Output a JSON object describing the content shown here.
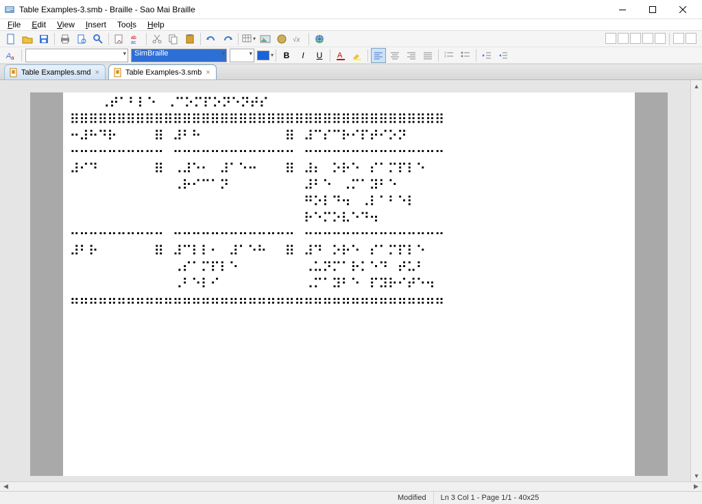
{
  "title": "Table Examples-3.smb - Braille - Sao Mai Braille",
  "menubar": [
    "File",
    "Edit",
    "View",
    "Insert",
    "Tools",
    "Help"
  ],
  "menubar_accel": [
    "F",
    "E",
    "V",
    "I",
    "l",
    "H"
  ],
  "toolbar1": {
    "new": "new",
    "open": "open",
    "save": "save",
    "print": "print",
    "preview": "preview",
    "find": "find",
    "goto": "goto",
    "abac": "abac",
    "cut": "cut",
    "copy": "copy",
    "paste": "paste",
    "undo": "undo",
    "redo": "redo",
    "table": "table",
    "image": "image",
    "link": "link",
    "formula": "formula",
    "globe": "globe"
  },
  "toolbar2": {
    "font_label": "",
    "translation_label": "SimBraille",
    "size_label": "",
    "color": "#1a63d9",
    "bold": "B",
    "italic": "I",
    "underline": "U"
  },
  "tabs": [
    {
      "label": "Table Examples.smd",
      "active": false
    },
    {
      "label": "Table Examples-3.smb",
      "active": true
    }
  ],
  "braille_lines": [
    "    ⠠⠞⠁⠃⠇⠑⠀⠠⠉⠕⠍⠏⠕⠝⠑⠝⠞⠎",
    "⠿⠿⠿⠿⠿⠿⠿⠿⠿⠿⠿⠿⠿⠿⠿⠿⠿⠿⠿⠿⠿⠿⠿⠿⠿⠿⠿⠿⠿⠿⠿⠿⠿⠿⠿⠿⠿⠿⠿⠿",
    "⠒⠼⠓⠙⠗⠀⠀⠀⠀⠿⠀⠼⠃⠓⠀⠀⠀⠀⠀⠀⠀⠀⠀⠿⠀⠼⠉⠎⠉⠗⠊⠏⠞⠊⠕⠝",
    "⠒⠒⠒⠒⠒⠒⠒⠒⠒⠒⠀⠒⠒⠒⠒⠒⠒⠒⠒⠒⠒⠒⠒⠒⠀⠒⠒⠒⠒⠒⠒⠒⠒⠒⠒⠒⠒⠒⠒⠒",
    "⠼⠊⠙⠀⠀⠀⠀⠀⠀⠿⠀⠠⠼⠑⠂⠀⠼⠁⠑⠒⠀⠀⠀⠿⠀⠼⠆⠀⠕⠗⠑⠀⠎⠁⠍⠏⠇⠑",
    "⠀⠀⠀⠀⠀⠀⠀⠀⠀⠀⠀⠠⠗⠊⠉⠁⠝⠀⠀⠀⠀⠀⠀⠀⠀⠼⠃⠑⠀⠠⠍⠁⠽⠃⠑",
    "⠀⠀⠀⠀⠀⠀⠀⠀⠀⠀⠀⠀⠀⠀⠀⠀⠀⠀⠀⠀⠀⠀⠀⠀⠀⠛⠕⠇⠙⠲⠀⠠⠇⠁⠃⠑⠇",
    "⠀⠀⠀⠀⠀⠀⠀⠀⠀⠀⠀⠀⠀⠀⠀⠀⠀⠀⠀⠀⠀⠀⠀⠀⠀⠗⠑⠍⠕⠧⠑⠙⠲",
    "⠒⠒⠒⠒⠒⠒⠒⠒⠒⠒⠀⠒⠒⠒⠒⠒⠒⠒⠒⠒⠒⠒⠒⠒⠀⠒⠒⠒⠒⠒⠒⠒⠒⠒⠒⠒⠒⠒⠒⠒",
    "⠼⠃⠗⠀⠀⠀⠀⠀⠀⠿⠀⠼⠉⠇⠇⠂⠀⠼⠁⠑⠓⠀⠀⠿⠀⠼⠙⠀⠕⠗⠑⠀⠎⠁⠍⠏⠇⠑",
    "⠀⠀⠀⠀⠀⠀⠀⠀⠀⠀⠀⠠⠎⠁⠍⠏⠇⠑⠀⠀⠀⠀⠀⠀⠀⠠⠥⠝⠍⠁⠗⠅⠑⠙⠀⠞⠥⠃",
    "⠀⠀⠀⠀⠀⠀⠀⠀⠀⠀⠀⠠⠃⠑⠇⠊⠀⠀⠀⠀⠀⠀⠀⠀⠀⠠⠍⠁⠽⠃⠑⠀⠏⠽⠗⠊⠞⠑⠲",
    "⠶⠶⠶⠶⠶⠶⠶⠶⠶⠶⠶⠶⠶⠶⠶⠶⠶⠶⠶⠶⠶⠶⠶⠶⠶⠶⠶⠶⠶⠶⠶⠶⠶⠶⠶⠶⠶⠶⠶⠶"
  ],
  "status": {
    "modified": "Modified",
    "pos": "Ln 3 Col 1 - Page 1/1 - 40x25"
  }
}
